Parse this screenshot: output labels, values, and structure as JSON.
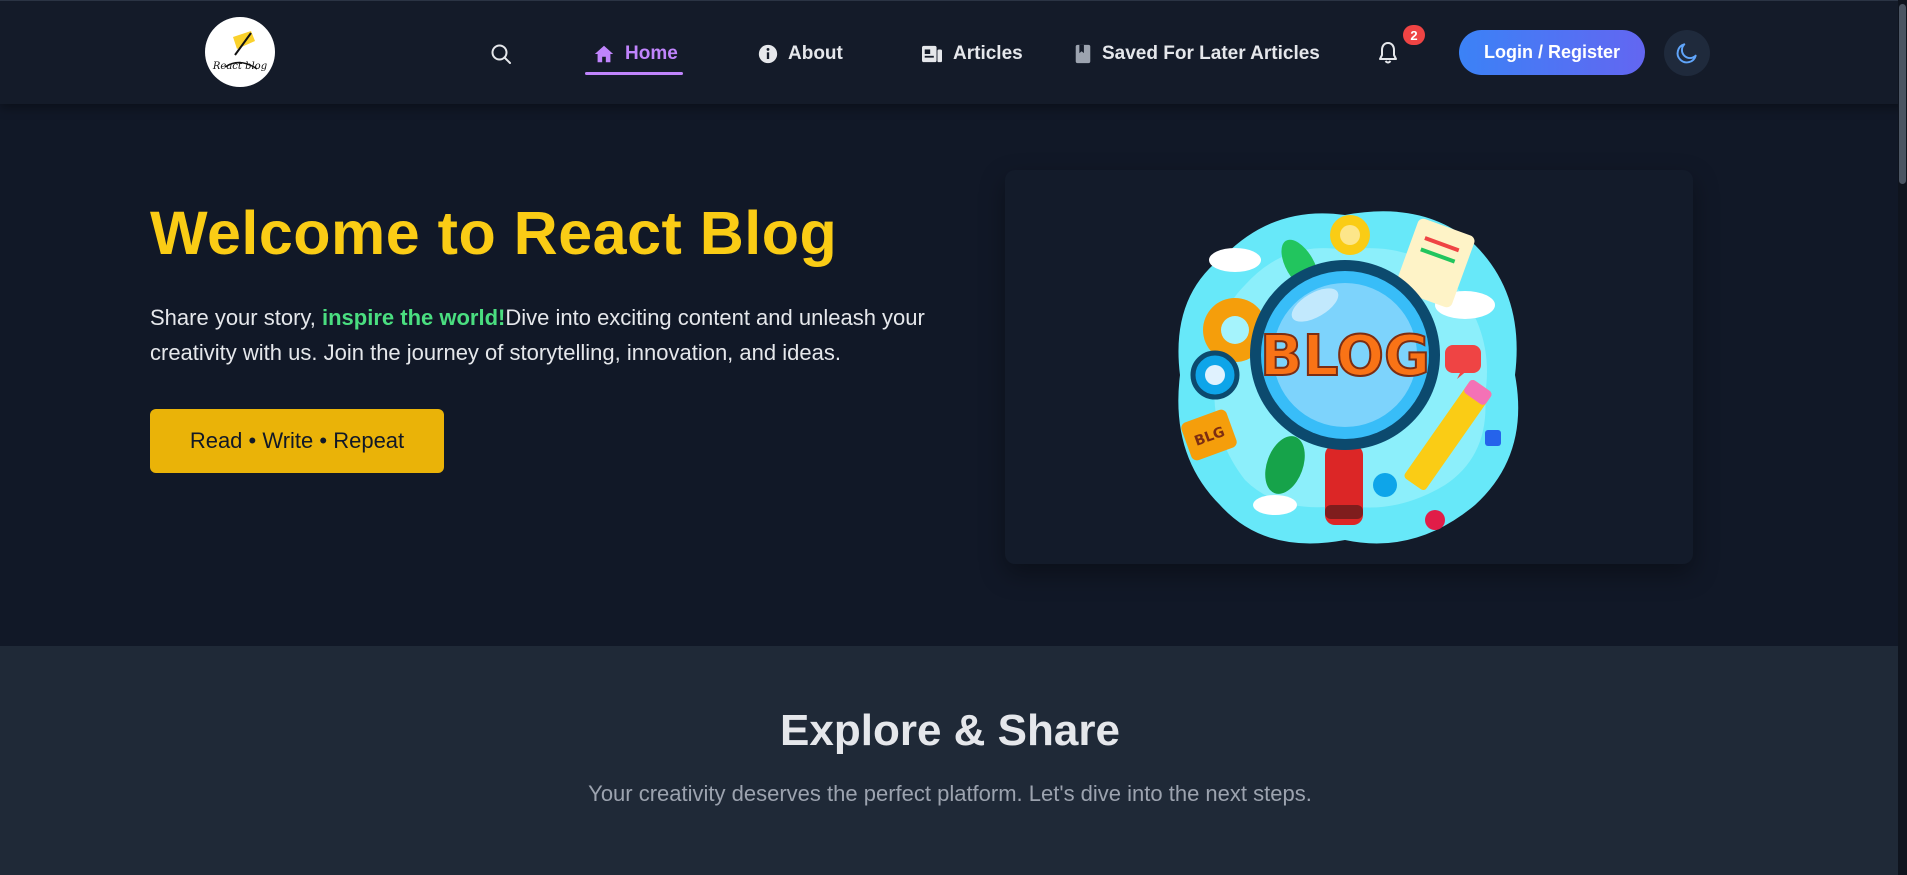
{
  "header": {
    "logo_text": "React blog",
    "nav": [
      {
        "label": "Home",
        "icon": "home-icon"
      },
      {
        "label": "About",
        "icon": "info-icon"
      },
      {
        "label": "Articles",
        "icon": "articles-icon"
      },
      {
        "label": "Saved For Later Articles",
        "icon": "bookmark-icon"
      }
    ],
    "notification_count": "2",
    "login_label": "Login / Register",
    "accent_color": "#c084fc"
  },
  "hero": {
    "title": "Welcome to React Blog",
    "text_part1": "Share your story, ",
    "text_highlight": "inspire the world!",
    "text_part2": "Dive into exciting content and unleash your creativity with us. Join the journey of storytelling, innovation, and ideas.",
    "cta_label": "Read • Write • Repeat",
    "illustration_text": "BLOG",
    "illustration_sticker_text": "BLG",
    "title_color": "#facc15",
    "highlight_color": "#4ade80"
  },
  "explore": {
    "title": "Explore & Share",
    "subtitle": "Your creativity deserves the perfect platform. Let's dive into the next steps."
  }
}
